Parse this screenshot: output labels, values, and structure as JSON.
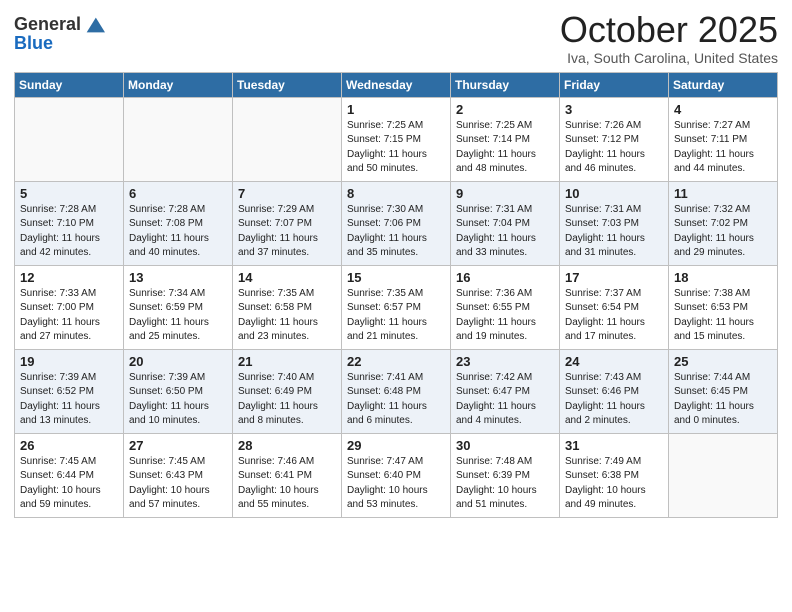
{
  "header": {
    "logo_general": "General",
    "logo_blue": "Blue",
    "month": "October 2025",
    "location": "Iva, South Carolina, United States"
  },
  "weekdays": [
    "Sunday",
    "Monday",
    "Tuesday",
    "Wednesday",
    "Thursday",
    "Friday",
    "Saturday"
  ],
  "weeks": [
    [
      {
        "day": "",
        "info": ""
      },
      {
        "day": "",
        "info": ""
      },
      {
        "day": "",
        "info": ""
      },
      {
        "day": "1",
        "info": "Sunrise: 7:25 AM\nSunset: 7:15 PM\nDaylight: 11 hours\nand 50 minutes."
      },
      {
        "day": "2",
        "info": "Sunrise: 7:25 AM\nSunset: 7:14 PM\nDaylight: 11 hours\nand 48 minutes."
      },
      {
        "day": "3",
        "info": "Sunrise: 7:26 AM\nSunset: 7:12 PM\nDaylight: 11 hours\nand 46 minutes."
      },
      {
        "day": "4",
        "info": "Sunrise: 7:27 AM\nSunset: 7:11 PM\nDaylight: 11 hours\nand 44 minutes."
      }
    ],
    [
      {
        "day": "5",
        "info": "Sunrise: 7:28 AM\nSunset: 7:10 PM\nDaylight: 11 hours\nand 42 minutes."
      },
      {
        "day": "6",
        "info": "Sunrise: 7:28 AM\nSunset: 7:08 PM\nDaylight: 11 hours\nand 40 minutes."
      },
      {
        "day": "7",
        "info": "Sunrise: 7:29 AM\nSunset: 7:07 PM\nDaylight: 11 hours\nand 37 minutes."
      },
      {
        "day": "8",
        "info": "Sunrise: 7:30 AM\nSunset: 7:06 PM\nDaylight: 11 hours\nand 35 minutes."
      },
      {
        "day": "9",
        "info": "Sunrise: 7:31 AM\nSunset: 7:04 PM\nDaylight: 11 hours\nand 33 minutes."
      },
      {
        "day": "10",
        "info": "Sunrise: 7:31 AM\nSunset: 7:03 PM\nDaylight: 11 hours\nand 31 minutes."
      },
      {
        "day": "11",
        "info": "Sunrise: 7:32 AM\nSunset: 7:02 PM\nDaylight: 11 hours\nand 29 minutes."
      }
    ],
    [
      {
        "day": "12",
        "info": "Sunrise: 7:33 AM\nSunset: 7:00 PM\nDaylight: 11 hours\nand 27 minutes."
      },
      {
        "day": "13",
        "info": "Sunrise: 7:34 AM\nSunset: 6:59 PM\nDaylight: 11 hours\nand 25 minutes."
      },
      {
        "day": "14",
        "info": "Sunrise: 7:35 AM\nSunset: 6:58 PM\nDaylight: 11 hours\nand 23 minutes."
      },
      {
        "day": "15",
        "info": "Sunrise: 7:35 AM\nSunset: 6:57 PM\nDaylight: 11 hours\nand 21 minutes."
      },
      {
        "day": "16",
        "info": "Sunrise: 7:36 AM\nSunset: 6:55 PM\nDaylight: 11 hours\nand 19 minutes."
      },
      {
        "day": "17",
        "info": "Sunrise: 7:37 AM\nSunset: 6:54 PM\nDaylight: 11 hours\nand 17 minutes."
      },
      {
        "day": "18",
        "info": "Sunrise: 7:38 AM\nSunset: 6:53 PM\nDaylight: 11 hours\nand 15 minutes."
      }
    ],
    [
      {
        "day": "19",
        "info": "Sunrise: 7:39 AM\nSunset: 6:52 PM\nDaylight: 11 hours\nand 13 minutes."
      },
      {
        "day": "20",
        "info": "Sunrise: 7:39 AM\nSunset: 6:50 PM\nDaylight: 11 hours\nand 10 minutes."
      },
      {
        "day": "21",
        "info": "Sunrise: 7:40 AM\nSunset: 6:49 PM\nDaylight: 11 hours\nand 8 minutes."
      },
      {
        "day": "22",
        "info": "Sunrise: 7:41 AM\nSunset: 6:48 PM\nDaylight: 11 hours\nand 6 minutes."
      },
      {
        "day": "23",
        "info": "Sunrise: 7:42 AM\nSunset: 6:47 PM\nDaylight: 11 hours\nand 4 minutes."
      },
      {
        "day": "24",
        "info": "Sunrise: 7:43 AM\nSunset: 6:46 PM\nDaylight: 11 hours\nand 2 minutes."
      },
      {
        "day": "25",
        "info": "Sunrise: 7:44 AM\nSunset: 6:45 PM\nDaylight: 11 hours\nand 0 minutes."
      }
    ],
    [
      {
        "day": "26",
        "info": "Sunrise: 7:45 AM\nSunset: 6:44 PM\nDaylight: 10 hours\nand 59 minutes."
      },
      {
        "day": "27",
        "info": "Sunrise: 7:45 AM\nSunset: 6:43 PM\nDaylight: 10 hours\nand 57 minutes."
      },
      {
        "day": "28",
        "info": "Sunrise: 7:46 AM\nSunset: 6:41 PM\nDaylight: 10 hours\nand 55 minutes."
      },
      {
        "day": "29",
        "info": "Sunrise: 7:47 AM\nSunset: 6:40 PM\nDaylight: 10 hours\nand 53 minutes."
      },
      {
        "day": "30",
        "info": "Sunrise: 7:48 AM\nSunset: 6:39 PM\nDaylight: 10 hours\nand 51 minutes."
      },
      {
        "day": "31",
        "info": "Sunrise: 7:49 AM\nSunset: 6:38 PM\nDaylight: 10 hours\nand 49 minutes."
      },
      {
        "day": "",
        "info": ""
      }
    ]
  ]
}
